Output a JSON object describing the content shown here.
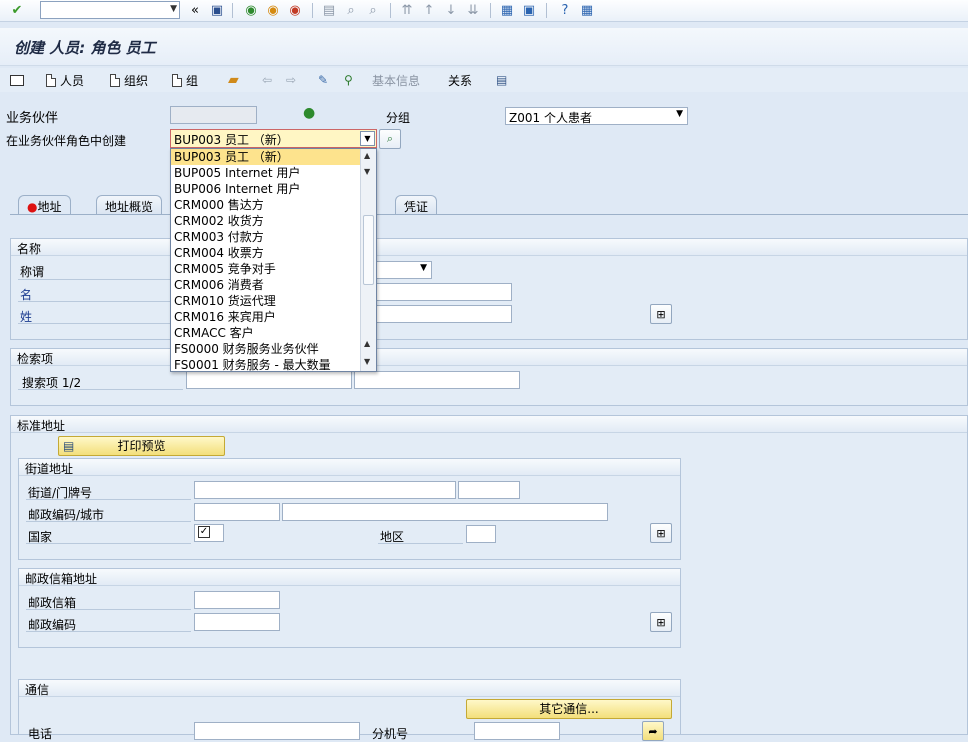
{
  "title": "创建 人员: 角色 员工",
  "app_toolbar": {
    "person": "人员",
    "org": "组织",
    "group": "组",
    "basic_info": "基本信息",
    "relations": "关系"
  },
  "header": {
    "bp_label": "业务伙伴",
    "role_label": "在业务伙伴角色中创建",
    "group_label": "分组",
    "group_value": "Z001 个人患者",
    "role_value": "BUP003 员工 （新）"
  },
  "role_options": [
    "BUP003 员工 （新）",
    "BUP005 Internet 用户",
    "BUP006 Internet 用户",
    "CRM000 售达方",
    "CRM002 收货方",
    "CRM003 付款方",
    "CRM004 收票方",
    "CRM005 竞争对手",
    "CRM006 消费者",
    "CRM010 货运代理",
    "CRM016 来宾用户",
    "CRMACC 客户",
    "FS0000 财务服务业务伙伴",
    "FS0001 财务服务 - 最大数量"
  ],
  "tabs": [
    "地址",
    "地址概览",
    "凭证"
  ],
  "name_group": {
    "title": "名称",
    "salutation": "称谓",
    "first_name": "名",
    "last_name": "姓"
  },
  "search_group": {
    "title": "检索项",
    "search_term": "搜索项 1/2"
  },
  "std_address": {
    "title": "标准地址",
    "print_preview": "打印预览",
    "street_title": "街道地址",
    "street": "街道/门牌号",
    "postal_city": "邮政编码/城市",
    "country": "国家",
    "region": "地区"
  },
  "po_box": {
    "title": "邮政信箱地址",
    "po_box": "邮政信箱",
    "postal_code": "邮政编码"
  },
  "comm": {
    "title": "通信",
    "other": "其它通信...",
    "phone": "电话",
    "ext": "分机号"
  }
}
